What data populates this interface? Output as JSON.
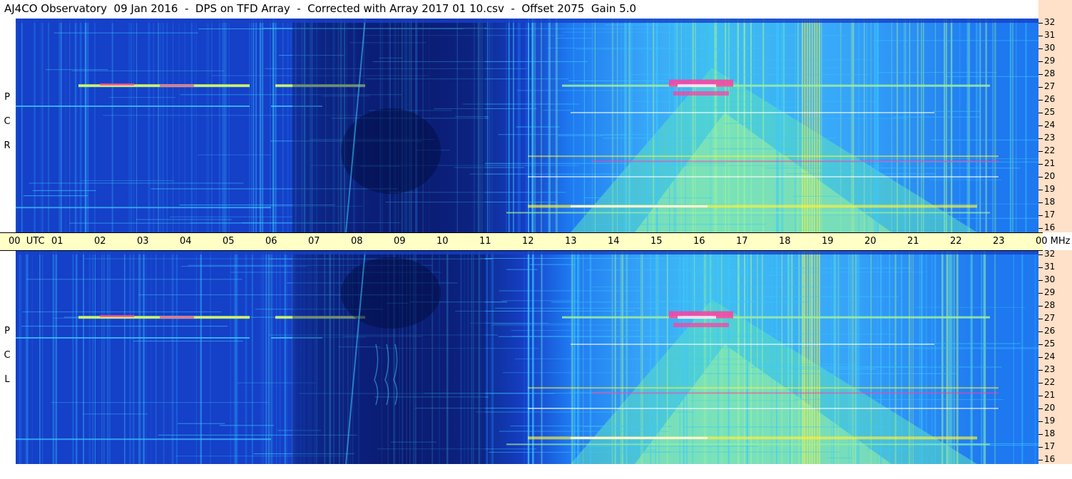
{
  "title": "AJ4CO Observatory  09 Jan 2016  -  DPS on TFD Array  -  Corrected with Array 2017 01 10.csv  -  Offset 2075  Gain 5.0",
  "chart_data": {
    "type": "heatmap",
    "x_unit": "UTC",
    "y_unit": "MHz",
    "x_ticks": [
      "00",
      "01",
      "02",
      "03",
      "04",
      "05",
      "06",
      "07",
      "08",
      "09",
      "10",
      "11",
      "12",
      "13",
      "14",
      "15",
      "16",
      "17",
      "18",
      "19",
      "20",
      "21",
      "22",
      "23",
      "00"
    ],
    "x_start_label": "00  UTC",
    "x_end_label": "00 MHz",
    "y_ticks": [
      32,
      31,
      30,
      29,
      28,
      27,
      26,
      25,
      24,
      23,
      22,
      21,
      20,
      19,
      18,
      17,
      16
    ],
    "ylim": [
      16,
      32
    ],
    "xlim_hours": [
      0,
      24
    ],
    "panels": [
      {
        "name": "RCP",
        "letters": [
          "R",
          "C",
          "P"
        ]
      },
      {
        "name": "LCP",
        "letters": [
          "L",
          "C",
          "P"
        ]
      }
    ],
    "colormap": [
      "#0a1a6e",
      "#1540c8",
      "#1e78f0",
      "#3cc8ff",
      "#9cf0a0",
      "#f8f040",
      "#ff40a0",
      "#ffffff"
    ],
    "features": {
      "dark_region_hours": [
        6.5,
        11.0
      ],
      "bright_band_hours": [
        12.0,
        23.5
      ],
      "peak_hours": [
        15.3,
        16.8
      ],
      "peak_band_mhz": [
        26.5,
        27.8
      ],
      "rfi_band_mhz": [
        27.0,
        27.3
      ],
      "strong_stripe_hours": [
        18.4,
        18.8
      ]
    }
  }
}
